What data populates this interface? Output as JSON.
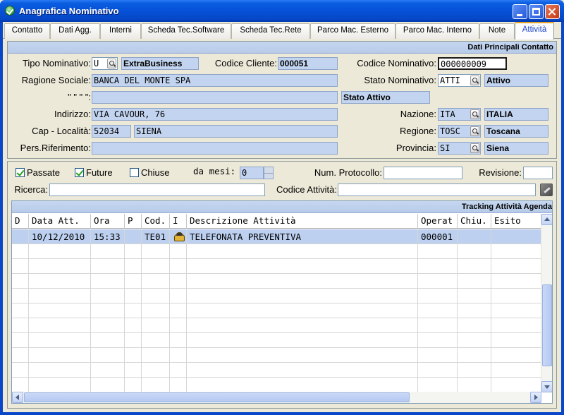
{
  "window": {
    "title": "Anagrafica Nominativo"
  },
  "tabs": [
    {
      "label": "Contatto"
    },
    {
      "label": "Dati Agg."
    },
    {
      "label": "Interni"
    },
    {
      "label": "Scheda Tec.Software"
    },
    {
      "label": "Scheda Tec.Rete"
    },
    {
      "label": "Parco Mac. Esterno"
    },
    {
      "label": "Parco Mac. Interno"
    },
    {
      "label": "Note"
    },
    {
      "label": "Attività",
      "active": true
    }
  ],
  "contact": {
    "header": "Dati Principali Contatto",
    "tipo_nominativo_label": "Tipo Nominativo:",
    "tipo_nominativo_code": "U",
    "tipo_nominativo_desc": "ExtraBusiness",
    "codice_cliente_label": "Codice Cliente:",
    "codice_cliente": "000051",
    "codice_nominativo_label": "Codice Nominativo:",
    "codice_nominativo": "000000009",
    "ragione_sociale_label": "Ragione Sociale:",
    "ragione_sociale": "BANCA DEL MONTE SPA",
    "stato_nominativo_label": "Stato Nominativo:",
    "stato_nominativo_code": "ATTI",
    "stato_nominativo_desc": "Attivo",
    "ditto_label": "\" \" \" \":",
    "ditto_value": "",
    "stato_attivo": "Stato Attivo",
    "indirizzo_label": "Indirizzo:",
    "indirizzo": "VIA CAVOUR, 76",
    "nazione_label": "Nazione:",
    "nazione_code": "ITA",
    "nazione_desc": "ITALIA",
    "cap_localita_label": "Cap - Località:",
    "cap": "52034",
    "localita": "SIENA",
    "regione_label": "Regione:",
    "regione_code": "TOSC",
    "regione_desc": "Toscana",
    "pers_riferimento_label": "Pers.Riferimento:",
    "pers_riferimento": "",
    "provincia_label": "Provincia:",
    "provincia_code": "SI",
    "provincia_desc": "Siena"
  },
  "filters": {
    "passate_label": "Passate",
    "passate_checked": true,
    "future_label": "Future",
    "future_checked": true,
    "chiuse_label": "Chiuse",
    "chiuse_checked": false,
    "da_mesi_label": "da mesi:",
    "da_mesi": "0",
    "num_protocollo_label": "Num. Protocollo:",
    "num_protocollo": "",
    "revisione_label": "Revisione:",
    "revisione": "",
    "ricerca_label": "Ricerca:",
    "ricerca": "",
    "codice_attivita_label": "Codice Attività:",
    "codice_attivita": ""
  },
  "grid": {
    "title": "Tracking Attività Agenda",
    "columns": [
      "D",
      "Data Att.",
      "Ora",
      "P",
      "Cod.",
      "I",
      "Descrizione Attività",
      "Operat",
      "Chiu.",
      "Esito"
    ],
    "rows": [
      {
        "d": "",
        "data": "10/12/2010",
        "ora": "15:33",
        "p": "",
        "cod": "TE01",
        "icon": "phone-icon",
        "descrizione": "TELEFONATA PREVENTIVA",
        "operat": "000001",
        "chiu": "",
        "esito": ""
      }
    ],
    "selection_color": "#bdd0f0"
  }
}
